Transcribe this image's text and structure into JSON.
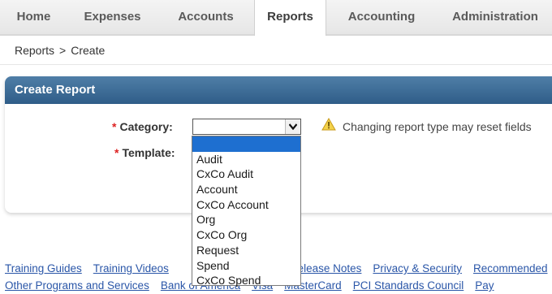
{
  "nav": {
    "tabs": [
      {
        "label": "Home"
      },
      {
        "label": "Expenses"
      },
      {
        "label": "Accounts"
      },
      {
        "label": "Reports"
      },
      {
        "label": "Accounting"
      },
      {
        "label": "Administration"
      }
    ],
    "active": "Reports"
  },
  "breadcrumb": {
    "items": [
      "Reports",
      "Create"
    ],
    "separator": ">"
  },
  "panel": {
    "title": "Create Report"
  },
  "form": {
    "required_marker": "*",
    "category_label": "Category:",
    "template_label": "Template:",
    "category_value": "",
    "warning": "Changing report type may reset fields"
  },
  "dropdown": {
    "options": [
      "",
      "Audit",
      "CxCo Audit",
      "Account",
      "CxCo Account",
      "Org",
      "CxCo Org",
      "Request",
      "Spend",
      "CxCo Spend"
    ],
    "highlighted_index": 0
  },
  "footer": {
    "row1": [
      "Training Guides",
      "Training Videos",
      "Release Notes",
      "Privacy & Security",
      "Recommended"
    ],
    "row2": [
      "Other Programs and Services",
      "Bank of America",
      "Visa",
      "MasterCard",
      "PCI Standards Council",
      "Pay"
    ]
  },
  "colors": {
    "header_blue": "#3a6890",
    "link": "#2a56a8",
    "required": "#dd2222",
    "highlight": "#1e6fd0"
  },
  "icons": {
    "warning": "warning-icon",
    "dropdown": "chevron-down-icon"
  }
}
